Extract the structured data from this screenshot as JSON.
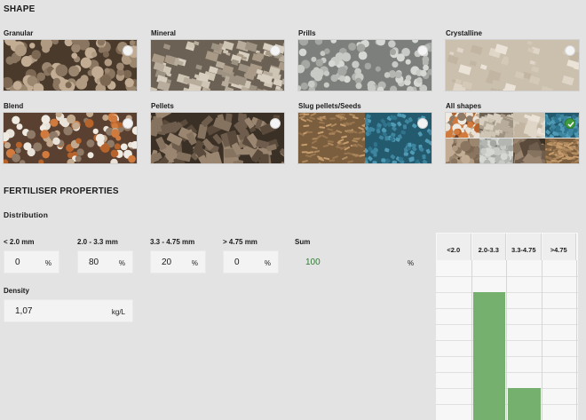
{
  "shape": {
    "title": "SHAPE",
    "options": [
      {
        "label": "Granular",
        "selected": false,
        "texture": "granular"
      },
      {
        "label": "Mineral",
        "selected": false,
        "texture": "mineral"
      },
      {
        "label": "Prills",
        "selected": false,
        "texture": "prills"
      },
      {
        "label": "Crystalline",
        "selected": false,
        "texture": "crystalline"
      },
      {
        "label": "Blend",
        "selected": false,
        "texture": "blend"
      },
      {
        "label": "Pellets",
        "selected": false,
        "texture": "pellets"
      },
      {
        "label": "Slug pellets/Seeds",
        "selected": false,
        "texture": "slug"
      },
      {
        "label": "All shapes",
        "selected": true,
        "texture": "all"
      }
    ]
  },
  "properties": {
    "title": "FERTILISER PROPERTIES",
    "distribution": {
      "label": "Distribution",
      "ranges": [
        {
          "label": "< 2.0 mm",
          "value": "0",
          "unit": "%"
        },
        {
          "label": "2.0 - 3.3 mm",
          "value": "80",
          "unit": "%"
        },
        {
          "label": "3.3 - 4.75 mm",
          "value": "20",
          "unit": "%"
        },
        {
          "label": "> 4.75 mm",
          "value": "0",
          "unit": "%"
        }
      ],
      "sum_label": "Sum",
      "sum_value": "100",
      "sum_unit": "%"
    },
    "density": {
      "label": "Density",
      "value": "1,07",
      "unit": "kg/L"
    }
  },
  "colors": {
    "accent_green": "#75b06e",
    "check_green": "#3e9b3e",
    "sum_green": "#2e7d32"
  },
  "chart_data": {
    "type": "bar",
    "categories": [
      "<2.0",
      "2.0-3.3",
      "3.3-4.75",
      ">4.75"
    ],
    "values": [
      0,
      80,
      20,
      0
    ],
    "ylim": [
      0,
      100
    ],
    "grid": true
  }
}
